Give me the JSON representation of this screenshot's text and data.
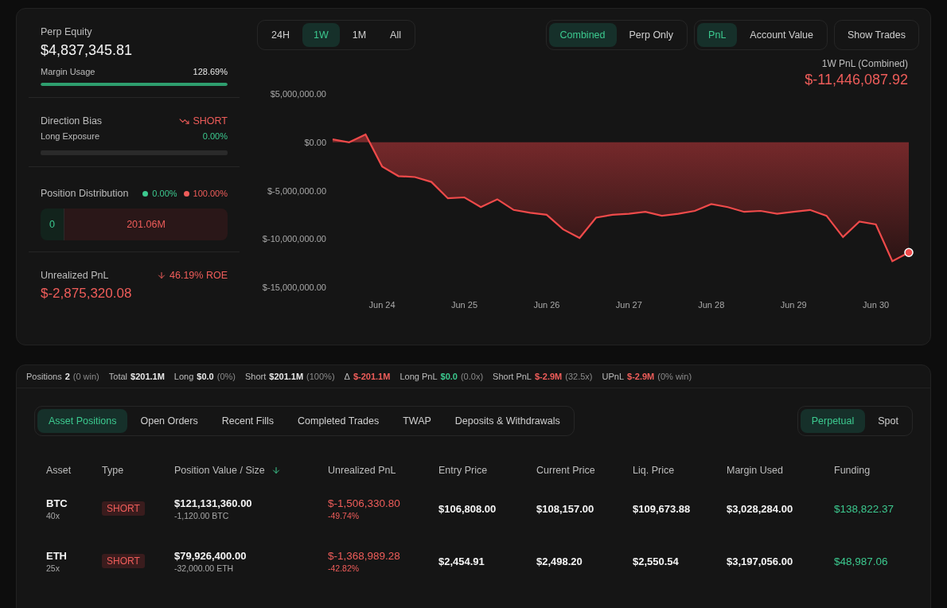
{
  "summary": {
    "perp_equity": {
      "label": "Perp Equity",
      "value": "$4,837,345.81"
    },
    "margin_usage": {
      "label": "Margin Usage",
      "value": "128.69%",
      "level": 1
    },
    "direction_bias": {
      "label": "Direction Bias",
      "value": "SHORT"
    },
    "long_exposure": {
      "label": "Long Exposure",
      "value": "0.00%",
      "level": 0
    },
    "position_distribution": {
      "label": "Position Distribution",
      "long_pct": "0.00%",
      "short_pct": "100.00%",
      "long_value": "0",
      "short_value": "201.06M"
    },
    "unrealized_pnl": {
      "label": "Unrealized PnL",
      "roe": "46.19% ROE",
      "value": "$-2,875,320.08"
    }
  },
  "range_tabs": [
    {
      "label": "24H",
      "selected": false
    },
    {
      "label": "1W",
      "selected": true
    },
    {
      "label": "1M",
      "selected": false
    },
    {
      "label": "All",
      "selected": false
    }
  ],
  "mode_tabs": [
    {
      "label": "Combined",
      "selected": true
    },
    {
      "label": "Perp Only",
      "selected": false
    }
  ],
  "metric_tabs": [
    {
      "label": "PnL",
      "selected": true
    },
    {
      "label": "Account Value",
      "selected": false
    }
  ],
  "show_trades_button": "Show Trades",
  "chart_header": {
    "title": "1W PnL (Combined)",
    "value": "$-11,446,087.92"
  },
  "chart_data": {
    "type": "area",
    "ylim": [
      -15000000,
      5000000
    ],
    "categories": [
      null,
      null,
      null,
      "Jun 24",
      null,
      null,
      null,
      null,
      "Jun 25",
      null,
      null,
      null,
      null,
      "Jun 26",
      null,
      null,
      null,
      null,
      "Jun 27",
      null,
      null,
      null,
      null,
      "Jun 28",
      null,
      null,
      null,
      null,
      "Jun 29",
      null,
      null,
      null,
      null,
      "Jun 30",
      null,
      null
    ],
    "yticks": [
      {
        "value": 5000000,
        "label": "$5,000,000.00"
      },
      {
        "value": 0,
        "label": "$0.00"
      },
      {
        "value": -5000000,
        "label": "$-5,000,000.00"
      },
      {
        "value": -10000000,
        "label": "$-10,000,000.00"
      },
      {
        "value": -15000000,
        "label": "$-15,000,000.00"
      }
    ],
    "series": [
      {
        "color": "#ef4a4a",
        "values": [
          300000,
          0,
          800000,
          -2500000,
          -3500000,
          -3600000,
          -4100000,
          -5800000,
          -5700000,
          -6700000,
          -5900000,
          -7000000,
          -7300000,
          -7500000,
          -9000000,
          -9900000,
          -7800000,
          -7500000,
          -7400000,
          -7200000,
          -7600000,
          -7400000,
          -7100000,
          -6400000,
          -6700000,
          -7200000,
          -7100000,
          -7400000,
          -7200000,
          -7000000,
          -7600000,
          -9800000,
          -8200000,
          -8500000,
          -12300000,
          -11400000
        ]
      }
    ]
  },
  "stats": [
    {
      "label": "Positions",
      "value": "2",
      "note": "(0 win)",
      "color": "#e8e8e8"
    },
    {
      "label": "Total",
      "value": "$201.1M",
      "color": "#e8e8e8"
    },
    {
      "label": "Long",
      "value": "$0.0",
      "note": "(0%)",
      "color": "#e8e8e8"
    },
    {
      "label": "Short",
      "value": "$201.1M",
      "note": "(100%)",
      "color": "#e8e8e8"
    },
    {
      "label": "Δ",
      "value": "$-201.1M",
      "color": "#ef5d5a"
    },
    {
      "label": "Long PnL",
      "value": "$0.0",
      "note": "(0.0x)",
      "color": "#3cc98f"
    },
    {
      "label": "Short PnL",
      "value": "$-2.9M",
      "note": "(32.5x)",
      "color": "#ef5d5a"
    },
    {
      "label": "UPnL",
      "value": "$-2.9M",
      "note": "(0% win)",
      "color": "#ef5d5a"
    }
  ],
  "position_tabs": [
    {
      "label": "Asset Positions",
      "selected": true
    },
    {
      "label": "Open Orders",
      "selected": false
    },
    {
      "label": "Recent Fills",
      "selected": false
    },
    {
      "label": "Completed Trades",
      "selected": false
    },
    {
      "label": "TWAP",
      "selected": false
    },
    {
      "label": "Deposits & Withdrawals",
      "selected": false
    }
  ],
  "market_tabs": [
    {
      "label": "Perpetual",
      "selected": true
    },
    {
      "label": "Spot",
      "selected": false
    }
  ],
  "table": {
    "columns": [
      {
        "label": "Asset",
        "sorted": false
      },
      {
        "label": "Type",
        "sorted": false
      },
      {
        "label": "Position Value / Size",
        "sorted": true
      },
      {
        "label": "Unrealized PnL",
        "sorted": false
      },
      {
        "label": "Entry Price",
        "sorted": false
      },
      {
        "label": "Current Price",
        "sorted": false
      },
      {
        "label": "Liq. Price",
        "sorted": false
      },
      {
        "label": "Margin Used",
        "sorted": false
      },
      {
        "label": "Funding",
        "sorted": false
      }
    ],
    "rows": [
      {
        "asset": "BTC",
        "leverage": "40x",
        "side": "SHORT",
        "position_value": "$121,131,360.00",
        "size": "-1,120.00 BTC",
        "upnl": "$-1,506,330.80",
        "upnl_pct": "-49.74%",
        "entry_price": "$106,808.00",
        "current_price": "$108,157.00",
        "liq_price": "$109,673.88",
        "margin_used": "$3,028,284.00",
        "funding": "$138,822.37"
      },
      {
        "asset": "ETH",
        "leverage": "25x",
        "side": "SHORT",
        "position_value": "$79,926,400.00",
        "size": "-32,000.00 ETH",
        "upnl": "$-1,368,989.28",
        "upnl_pct": "-42.82%",
        "entry_price": "$2,454.91",
        "current_price": "$2,498.20",
        "liq_price": "$2,550.54",
        "margin_used": "$3,197,056.00",
        "funding": "$48,987.06"
      }
    ]
  }
}
